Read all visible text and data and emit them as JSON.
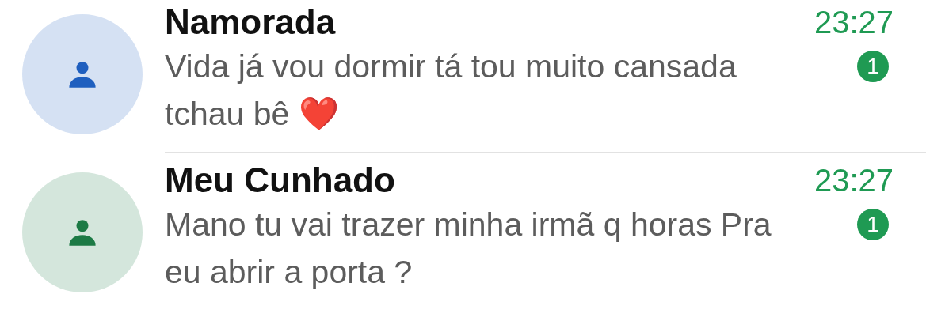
{
  "chats": [
    {
      "name": "Namorada",
      "time": "23:27",
      "message": "Vida já vou dormir tá tou muito cansada tchau bê ❤️",
      "unread": "1",
      "color": "#1f5fbf"
    },
    {
      "name": "Meu Cunhado",
      "time": "23:27",
      "message": "Mano tu vai trazer minha irmã q horas Pra eu abrir a porta ?",
      "unread": "1",
      "color": "#1c7a45"
    }
  ]
}
